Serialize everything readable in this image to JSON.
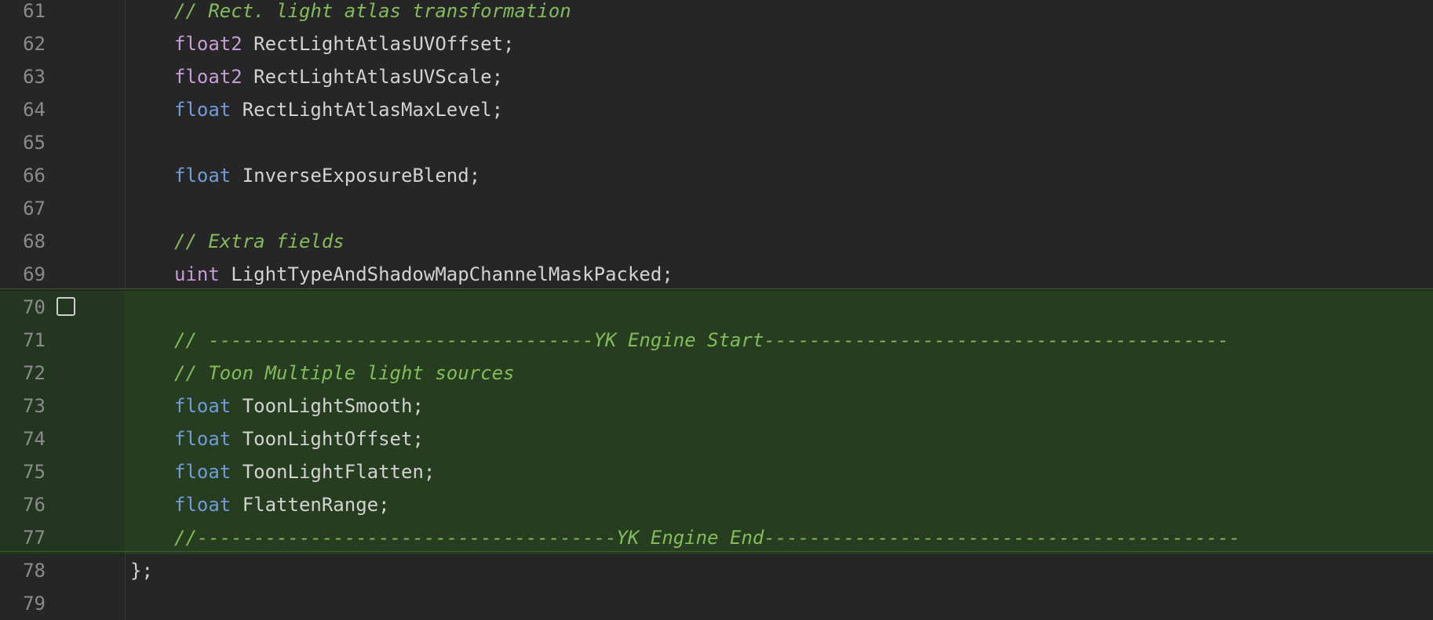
{
  "editor": {
    "lines": [
      {
        "n": "61",
        "added": false,
        "tokens": [
          {
            "t": "comment",
            "v": "// Rect. light atlas transformation"
          }
        ]
      },
      {
        "n": "62",
        "added": false,
        "tokens": [
          {
            "t": "kw-float2",
            "v": "float2"
          },
          {
            "t": "ident",
            "v": " RectLightAtlasUVOffset"
          },
          {
            "t": "punct",
            "v": ";"
          }
        ]
      },
      {
        "n": "63",
        "added": false,
        "tokens": [
          {
            "t": "kw-float2",
            "v": "float2"
          },
          {
            "t": "ident",
            "v": " RectLightAtlasUVScale"
          },
          {
            "t": "punct",
            "v": ";"
          }
        ]
      },
      {
        "n": "64",
        "added": false,
        "tokens": [
          {
            "t": "kw-float",
            "v": "float"
          },
          {
            "t": "ident",
            "v": " RectLightAtlasMaxLevel"
          },
          {
            "t": "punct",
            "v": ";"
          }
        ]
      },
      {
        "n": "65",
        "added": false,
        "tokens": []
      },
      {
        "n": "66",
        "added": false,
        "tokens": [
          {
            "t": "kw-float",
            "v": "float"
          },
          {
            "t": "ident",
            "v": " InverseExposureBlend"
          },
          {
            "t": "punct",
            "v": ";"
          }
        ]
      },
      {
        "n": "67",
        "added": false,
        "tokens": []
      },
      {
        "n": "68",
        "added": false,
        "tokens": [
          {
            "t": "comment",
            "v": "// Extra fields"
          }
        ]
      },
      {
        "n": "69",
        "added": false,
        "tokens": [
          {
            "t": "kw-uint",
            "v": "uint"
          },
          {
            "t": "ident",
            "v": " LightTypeAndShadowMapChannelMaskPacked"
          },
          {
            "t": "punct",
            "v": ";"
          }
        ]
      },
      {
        "n": "70",
        "added": true,
        "checkbox": true,
        "tokens": []
      },
      {
        "n": "71",
        "added": true,
        "tokens": [
          {
            "t": "comment",
            "v": "// ----------------------------------YK Engine Start-----------------------------------------"
          }
        ]
      },
      {
        "n": "72",
        "added": true,
        "tokens": [
          {
            "t": "comment",
            "v": "// Toon Multiple light sources"
          }
        ]
      },
      {
        "n": "73",
        "added": true,
        "tokens": [
          {
            "t": "kw-float",
            "v": "float"
          },
          {
            "t": "ident",
            "v": " ToonLightSmooth"
          },
          {
            "t": "punct",
            "v": ";"
          }
        ]
      },
      {
        "n": "74",
        "added": true,
        "tokens": [
          {
            "t": "kw-float",
            "v": "float"
          },
          {
            "t": "ident",
            "v": " ToonLightOffset"
          },
          {
            "t": "punct",
            "v": ";"
          }
        ]
      },
      {
        "n": "75",
        "added": true,
        "tokens": [
          {
            "t": "kw-float",
            "v": "float"
          },
          {
            "t": "ident",
            "v": " ToonLightFlatten"
          },
          {
            "t": "punct",
            "v": ";"
          }
        ]
      },
      {
        "n": "76",
        "added": true,
        "tokens": [
          {
            "t": "kw-float",
            "v": "float"
          },
          {
            "t": "ident",
            "v": " FlattenRange"
          },
          {
            "t": "punct",
            "v": ";"
          }
        ]
      },
      {
        "n": "77",
        "added": true,
        "tokens": [
          {
            "t": "comment",
            "v": "//-------------------------------------YK Engine End------------------------------------------"
          }
        ]
      },
      {
        "n": "78",
        "added": false,
        "indent": 0,
        "tokens": [
          {
            "t": "punct",
            "v": "};"
          }
        ]
      },
      {
        "n": "79",
        "added": false,
        "tokens": []
      }
    ],
    "colors": {
      "background": "#262626",
      "added_line": "#273d20",
      "comment": "#84bb5a",
      "keyword_float": "#6f9bd8",
      "keyword_float2_uint": "#c79bd8"
    }
  }
}
